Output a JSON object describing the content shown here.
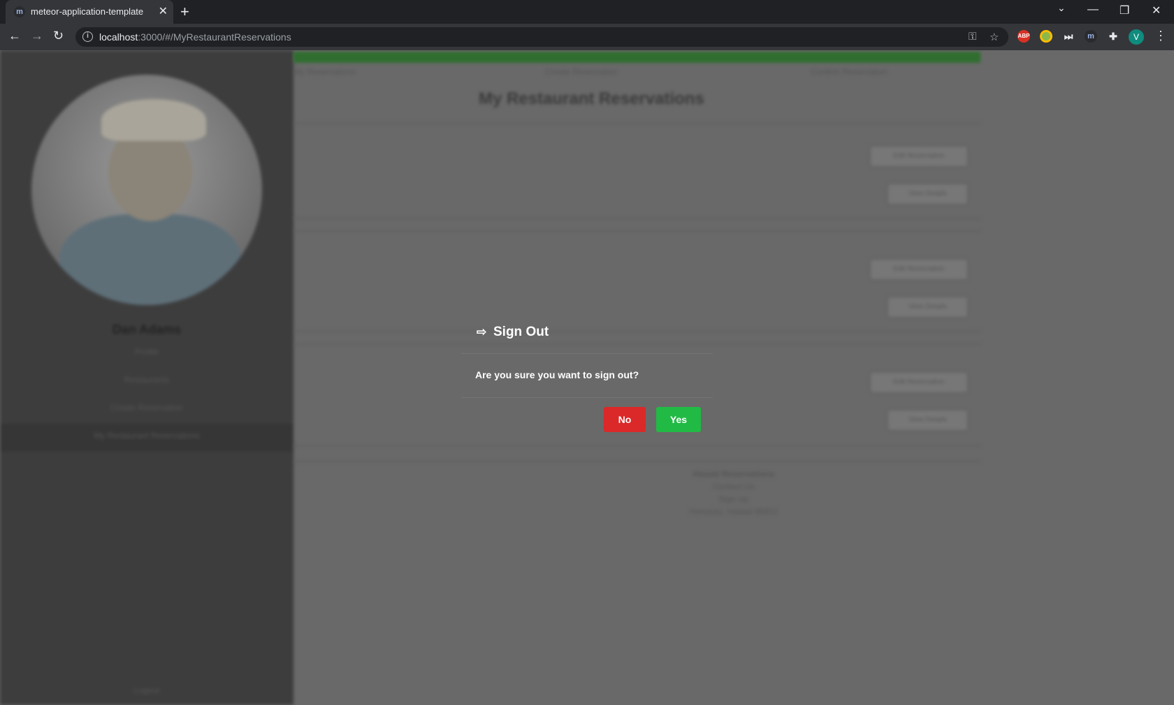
{
  "browser": {
    "tab_title": "meteor-application-template",
    "tab_close": "✕",
    "new_tab": "+",
    "url_host": "localhost",
    "url_path": ":3000/#/MyRestaurantReservations",
    "info_icon": "i",
    "key_icon": "⚿",
    "star_icon": "☆",
    "ext_abp": "ABP",
    "avatar_letter": "V",
    "menu": "⋮",
    "back": "←",
    "forward": "→",
    "reload": "↻",
    "minimize": "—",
    "restore": "❐",
    "close_window": "✕"
  },
  "sidebar": {
    "name": "Dan Adams",
    "items": [
      "Profile",
      "Restaurants",
      "Create Reservation",
      "My Restaurant Reservations"
    ],
    "logout": "Logout"
  },
  "main": {
    "nav": [
      "My Reservations",
      "Create Reservation",
      "Confirm Reservation"
    ],
    "title": "My Restaurant Reservations",
    "row_buttons": [
      "Edit Reservation",
      "View Details"
    ],
    "footer": [
      "Hawaii Reservations",
      "Contact Us",
      "Sign Up",
      "Honolulu, Hawaii 96822"
    ]
  },
  "modal": {
    "icon": "signout-icon",
    "title": "Sign Out",
    "message": "Are you sure you want to sign out?",
    "no_label": "No",
    "yes_label": "Yes",
    "no_color": "#db2828",
    "yes_color": "#21ba45"
  }
}
